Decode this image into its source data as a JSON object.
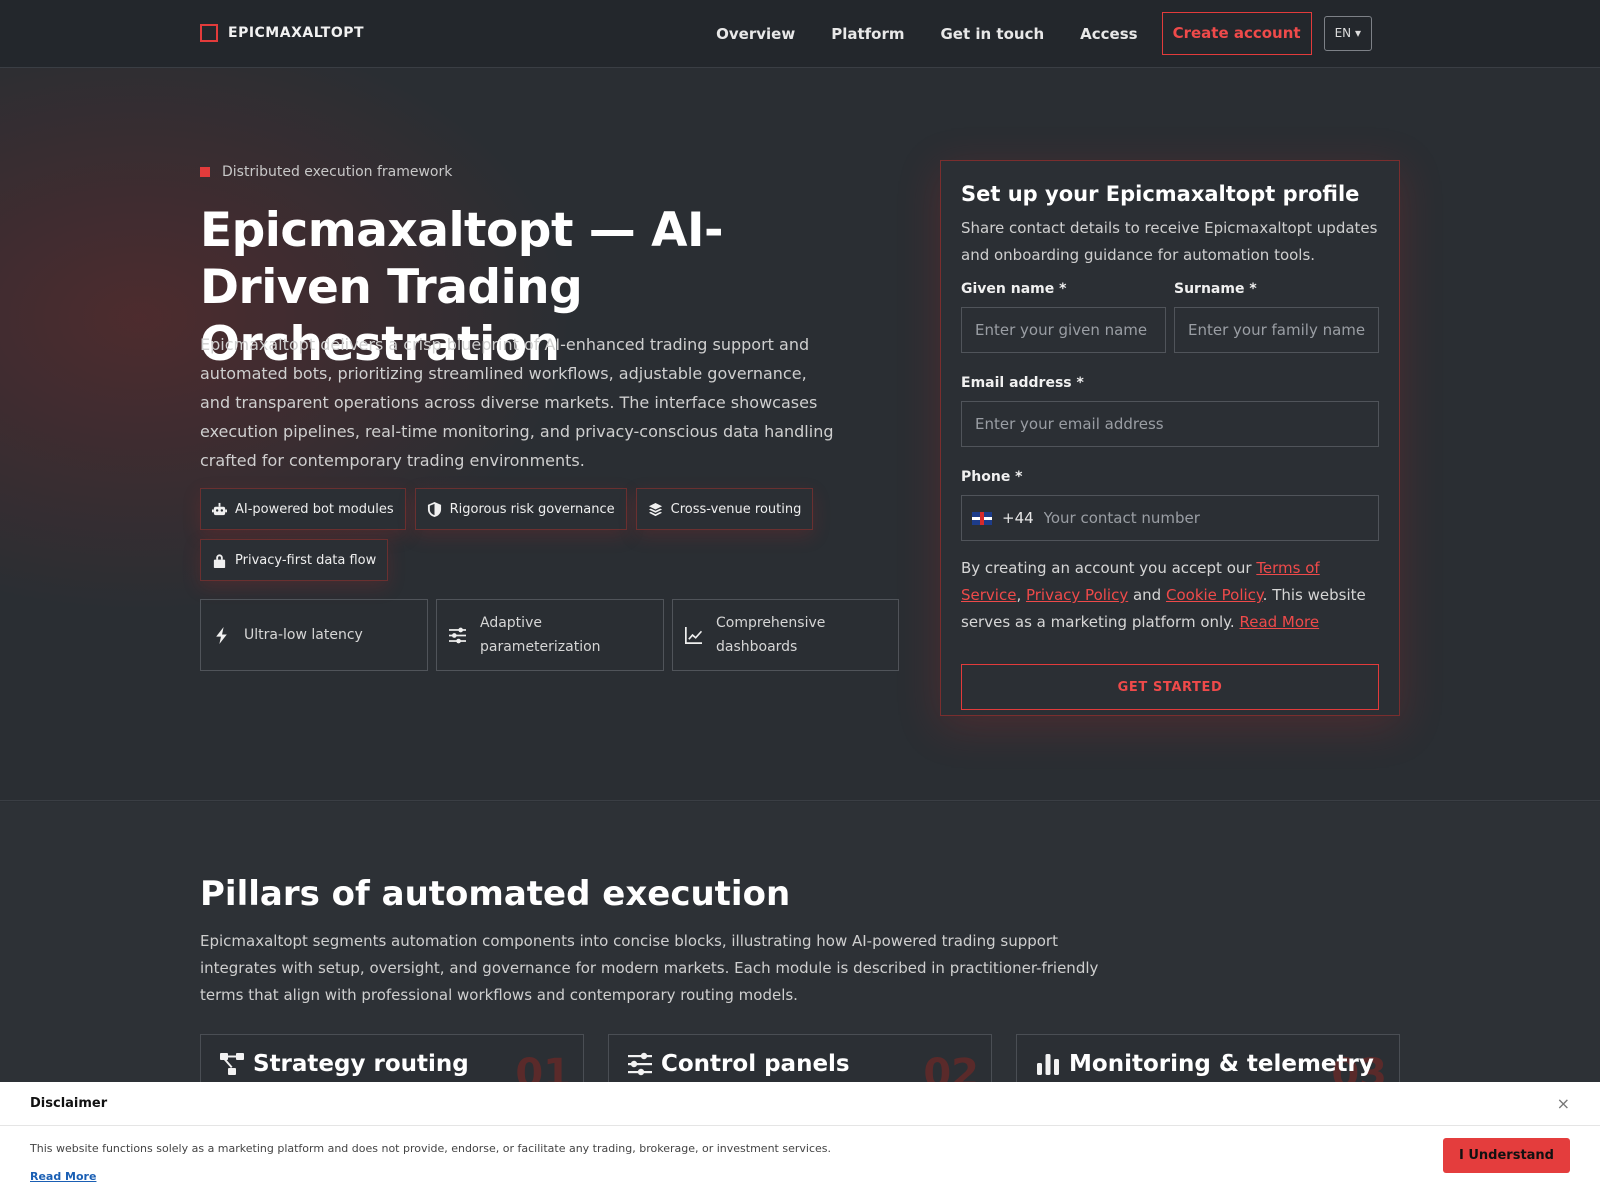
{
  "header": {
    "logo_text": "EPICMAXALTOPT",
    "nav": [
      "Overview",
      "Platform",
      "Get in touch",
      "Access"
    ],
    "cta": "Create account",
    "lang": "EN ▾"
  },
  "hero": {
    "eyebrow": "Distributed execution framework",
    "title": "Epicmaxaltopt — AI-Driven Trading Orchestration",
    "description": "Epicmaxaltopt delivers a crisp blueprint of AI-enhanced trading support and automated bots, prioritizing streamlined workflows, adjustable governance, and transparent operations across diverse markets. The interface showcases execution pipelines, real-time monitoring, and privacy-conscious data handling crafted for contemporary trading environments.",
    "chips": [
      {
        "label": "AI-powered bot modules",
        "icon": "robot-icon"
      },
      {
        "label": "Rigorous risk governance",
        "icon": "shield-icon"
      },
      {
        "label": "Cross-venue routing",
        "icon": "layers-icon"
      },
      {
        "label": "Privacy-first data flow",
        "icon": "lock-icon"
      }
    ],
    "features": [
      {
        "label": "Ultra-low latency",
        "icon": "bolt-icon"
      },
      {
        "label": "Adaptive parameterization",
        "icon": "sliders-icon"
      },
      {
        "label": "Comprehensive dashboards",
        "icon": "chart-line-icon"
      }
    ]
  },
  "form": {
    "title": "Set up your Epicmaxaltopt profile",
    "subtitle": "Share contact details to receive Epicmaxaltopt updates and onboarding guidance for automation tools.",
    "given_label": "Given name *",
    "given_placeholder": "Enter your given name",
    "surname_label": "Surname *",
    "surname_placeholder": "Enter your family name",
    "email_label": "Email address *",
    "email_placeholder": "Enter your email address",
    "phone_label": "Phone *",
    "phone_code": "+44",
    "phone_placeholder": "Your contact number",
    "terms_prefix": "By creating an account you accept our ",
    "terms_link": "Terms of Service",
    "terms_sep": ", ",
    "privacy_link": "Privacy Policy",
    "terms_and": " and ",
    "cookie_link": "Cookie Policy",
    "terms_suffix": ". This website serves as a marketing platform only. ",
    "read_more": "Read More",
    "submit": "GET STARTED"
  },
  "pillars": {
    "title": "Pillars of automated execution",
    "description": "Epicmaxaltopt segments automation components into concise blocks, illustrating how AI-powered trading support integrates with setup, oversight, and governance for modern markets. Each module is described in practitioner-friendly terms that align with professional workflows and contemporary routing models.",
    "cards": [
      {
        "title": "Strategy routing",
        "num": "01",
        "icon": "routing-icon"
      },
      {
        "title": "Control panels",
        "num": "02",
        "icon": "sliders-icon"
      },
      {
        "title": "Monitoring & telemetry",
        "num": "03",
        "icon": "bar-chart-icon"
      }
    ]
  },
  "disclaimer": {
    "title": "Disclaimer",
    "close": "×",
    "text": "This website functions solely as a marketing platform and does not provide, endorse, or facilitate any trading, brokerage, or investment services.",
    "link": "Read More",
    "button": "I Understand"
  },
  "colors": {
    "accent": "#e23b3b",
    "background": "#2a2e33"
  }
}
